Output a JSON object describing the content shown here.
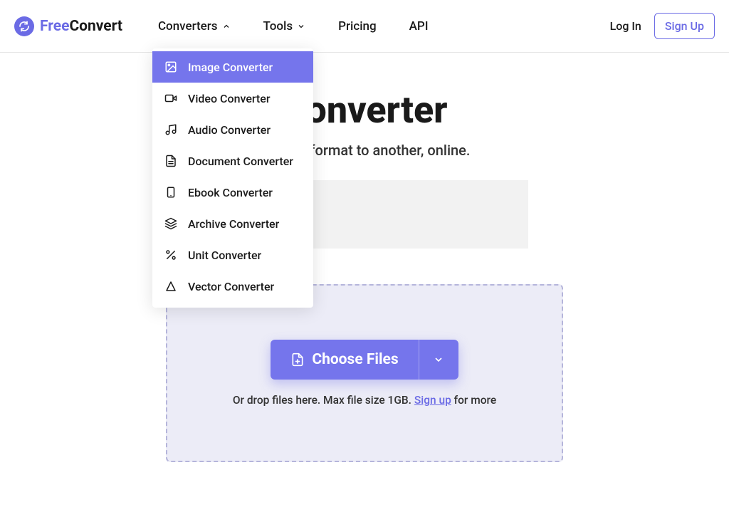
{
  "colors": {
    "accent": "#6b6be5",
    "button": "#7575ec",
    "dropzone_bg": "#ececf7",
    "dropzone_border": "#b5b5db"
  },
  "header": {
    "logo_free": "Free",
    "logo_convert": "Convert",
    "nav": {
      "converters": "Converters",
      "tools": "Tools",
      "pricing": "Pricing",
      "api": "API"
    },
    "login": "Log In",
    "signup": "Sign Up"
  },
  "hero": {
    "title_partial_visible": "Converter",
    "subtitle_partial_visible": "om one format to another, online."
  },
  "dropdown": {
    "items": [
      {
        "icon": "image-icon",
        "label": "Image Converter",
        "active": true
      },
      {
        "icon": "video-icon",
        "label": "Video Converter",
        "active": false
      },
      {
        "icon": "audio-icon",
        "label": "Audio Converter",
        "active": false
      },
      {
        "icon": "document-icon",
        "label": "Document Converter",
        "active": false
      },
      {
        "icon": "ebook-icon",
        "label": "Ebook Converter",
        "active": false
      },
      {
        "icon": "archive-icon",
        "label": "Archive Converter",
        "active": false
      },
      {
        "icon": "unit-icon",
        "label": "Unit Converter",
        "active": false
      },
      {
        "icon": "vector-icon",
        "label": "Vector Converter",
        "active": false
      }
    ]
  },
  "upload": {
    "choose_label": "Choose Files",
    "hint_prefix": "Or drop files here. Max file size 1GB. ",
    "hint_link": "Sign up",
    "hint_suffix": " for more"
  }
}
